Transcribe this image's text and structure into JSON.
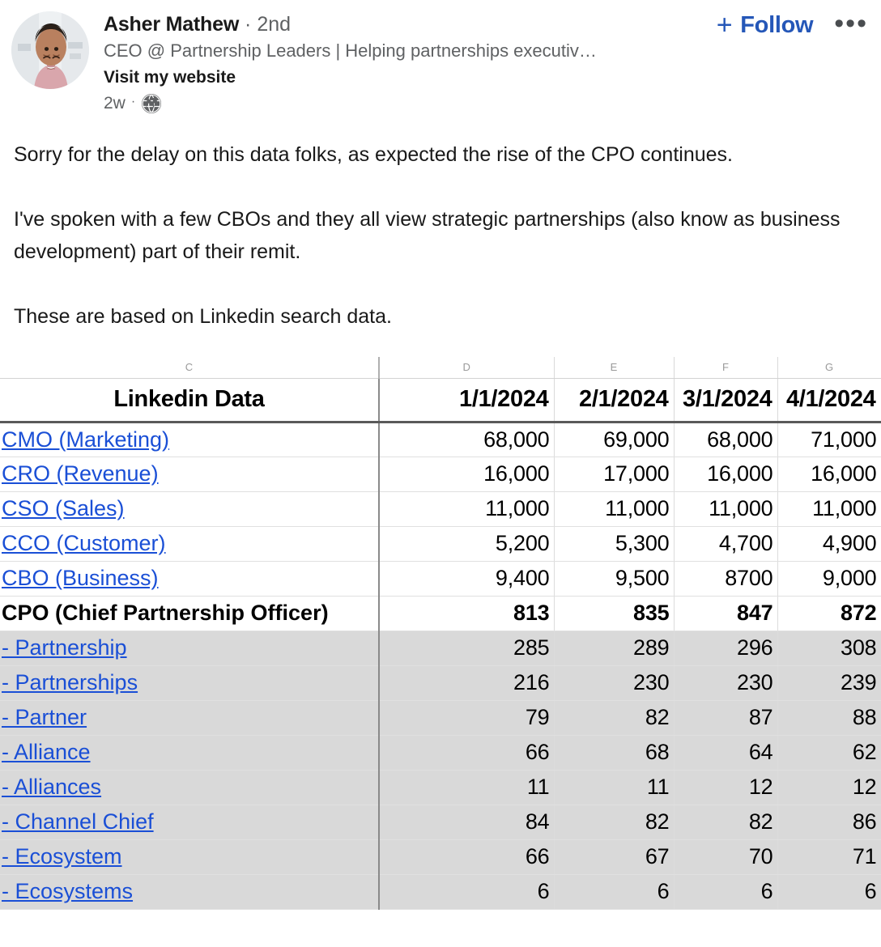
{
  "post": {
    "author": {
      "name": "Asher Mathew",
      "separator": "·",
      "degree": "2nd",
      "headline": "CEO @ Partnership Leaders | Helping partnerships executiv…",
      "website_link": "Visit my website",
      "avatar_alt": "avatar-photo"
    },
    "meta": {
      "timestamp": "2w",
      "separator": "·",
      "visibility_icon": "globe-icon"
    },
    "actions": {
      "follow_label": "Follow",
      "follow_plus": "+",
      "more_label": "•••"
    },
    "body": {
      "paragraph_1": "Sorry for the delay on this data folks, as expected the rise of the CPO continues.",
      "paragraph_2": "I've spoken with a few CBOs and they all view strategic partnerships (also know as business development) part of their remit.",
      "paragraph_3": "These are based on Linkedin search data."
    },
    "colors": {
      "link_blue": "#2557b8",
      "cell_link_blue": "#1a4fd6",
      "text_dark": "#191919",
      "text_gray": "#5f6163",
      "shaded_row": "#d9d9d9"
    }
  },
  "spreadsheet": {
    "column_letters": [
      "C",
      "D",
      "E",
      "F",
      "G"
    ],
    "headers": [
      "Linkedin Data",
      "1/1/2024",
      "2/1/2024",
      "3/1/2024",
      "4/1/2024"
    ],
    "rows": [
      {
        "label": "CMO (Marketing)",
        "style": "link",
        "shaded": false,
        "values": [
          "68,000",
          "69,000",
          "68,000",
          "71,000"
        ]
      },
      {
        "label": "CRO (Revenue)",
        "style": "link",
        "shaded": false,
        "values": [
          "16,000",
          "17,000",
          "16,000",
          "16,000"
        ]
      },
      {
        "label": "CSO (Sales)",
        "style": "link",
        "shaded": false,
        "values": [
          "11,000",
          "11,000",
          "11,000",
          "11,000"
        ]
      },
      {
        "label": "CCO (Customer)",
        "style": "link",
        "shaded": false,
        "values": [
          "5,200",
          "5,300",
          "4,700",
          "4,900"
        ]
      },
      {
        "label": "CBO (Business)",
        "style": "link",
        "shaded": false,
        "values": [
          "9,400",
          "9,500",
          "8700",
          "9,000"
        ]
      },
      {
        "label": "CPO (Chief Partnership Officer)",
        "style": "bold",
        "shaded": false,
        "values": [
          "813",
          "835",
          "847",
          "872"
        ]
      },
      {
        "label": "- Partnership",
        "style": "link",
        "shaded": true,
        "values": [
          "285",
          "289",
          "296",
          "308"
        ]
      },
      {
        "label": "- Partnerships",
        "style": "link",
        "shaded": true,
        "values": [
          "216",
          "230",
          "230",
          "239"
        ]
      },
      {
        "label": "- Partner",
        "style": "link",
        "shaded": true,
        "values": [
          "79",
          "82",
          "87",
          "88"
        ]
      },
      {
        "label": "- Alliance",
        "style": "link",
        "shaded": true,
        "values": [
          "66",
          "68",
          "64",
          "62"
        ]
      },
      {
        "label": "- Alliances",
        "style": "link",
        "shaded": true,
        "values": [
          "11",
          "11",
          "12",
          "12"
        ]
      },
      {
        "label": "- Channel Chief",
        "style": "link",
        "shaded": true,
        "values": [
          "84",
          "82",
          "82",
          "86"
        ]
      },
      {
        "label": "- Ecosystem",
        "style": "link",
        "shaded": true,
        "values": [
          "66",
          "67",
          "70",
          "71"
        ]
      },
      {
        "label": "- Ecosystems",
        "style": "link",
        "shaded": true,
        "values": [
          "6",
          "6",
          "6",
          "6"
        ]
      }
    ]
  }
}
